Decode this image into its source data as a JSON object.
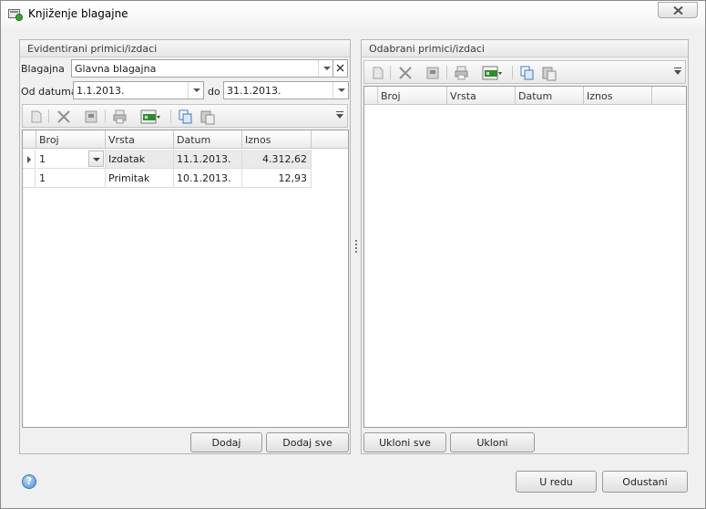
{
  "window": {
    "title": "Knjiženje blagajne"
  },
  "left_panel": {
    "title": "Evidentirani primici/izdaci",
    "blagajna_label": "Blagajna",
    "blagajna_value": "Glavna blagajna",
    "od_datuma_label": "Od datuma",
    "od_datuma_value": "1.1.2013.",
    "do_label": "do",
    "do_value": "31.1.2013.",
    "grid": {
      "columns": [
        "Broj",
        "Vrsta",
        "Datum",
        "Iznos"
      ],
      "rows": [
        {
          "broj": "1",
          "vrsta": "Izdatak",
          "datum": "11.1.2013.",
          "iznos": "4.312,62",
          "selected": true
        },
        {
          "broj": "1",
          "vrsta": "Primitak",
          "datum": "10.1.2013.",
          "iznos": "12,93",
          "selected": false
        }
      ]
    },
    "buttons": {
      "dodaj": "Dodaj",
      "dodaj_sve": "Dodaj sve"
    }
  },
  "right_panel": {
    "title": "Odabrani primici/izdaci",
    "grid": {
      "columns": [
        "Broj",
        "Vrsta",
        "Datum",
        "Iznos"
      ]
    },
    "buttons": {
      "ukloni_sve": "Ukloni sve",
      "ukloni": "Ukloni"
    }
  },
  "footer": {
    "ok": "U redu",
    "cancel": "Odustani",
    "help_glyph": "?"
  },
  "icons": {
    "toolbar": [
      "new-icon",
      "delete-icon",
      "save-icon",
      "print-icon",
      "export-xls-icon",
      "copy-icon",
      "paste-icon",
      "overflow-icon"
    ],
    "window": [
      "app-icon",
      "close-icon",
      "help-icon"
    ]
  },
  "colors": {
    "xls_green": "#2e8b2e",
    "copy_blue": "#3a78c8"
  }
}
